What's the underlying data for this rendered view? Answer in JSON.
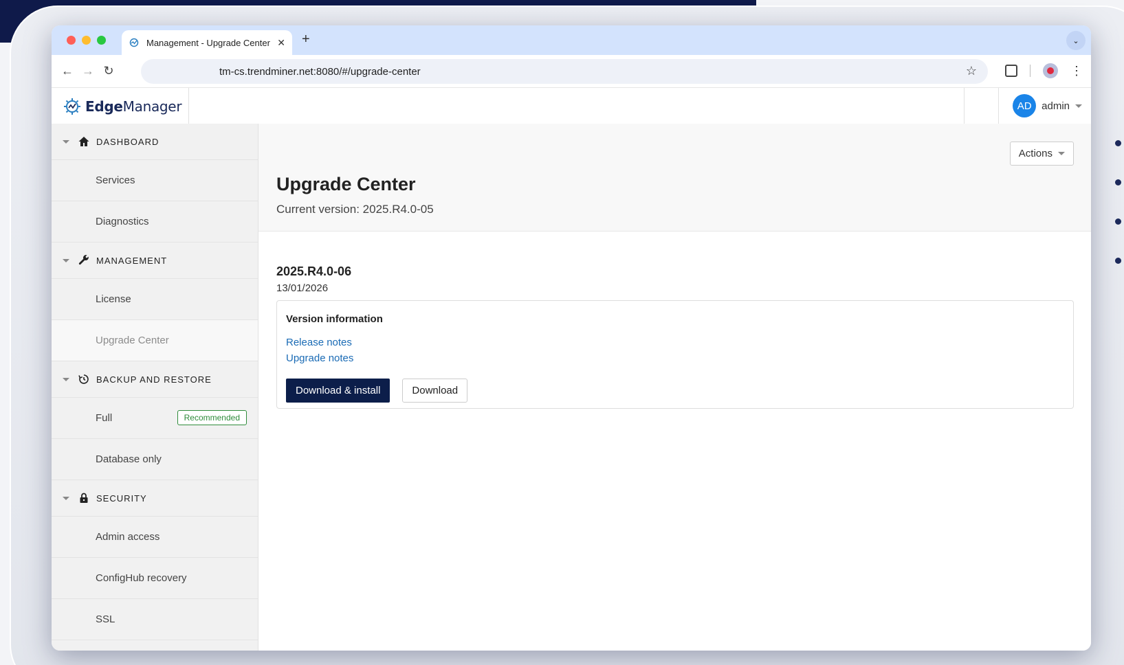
{
  "browser": {
    "tab_title": "Management - Upgrade Center",
    "url": "tm-cs.trendminer.net:8080/#/upgrade-center"
  },
  "app": {
    "brand_bold": "Edge",
    "brand_light": "Manager",
    "user_initials": "AD",
    "user_name": "admin"
  },
  "sidebar": {
    "sections": [
      {
        "label": "DASHBOARD",
        "icon": "home-icon",
        "items": [
          {
            "label": "Services"
          },
          {
            "label": "Diagnostics"
          }
        ]
      },
      {
        "label": "MANAGEMENT",
        "icon": "wrench-icon",
        "items": [
          {
            "label": "License"
          },
          {
            "label": "Upgrade Center",
            "active": true
          }
        ]
      },
      {
        "label": "BACKUP AND RESTORE",
        "icon": "history-icon",
        "items": [
          {
            "label": "Full",
            "badge": "Recommended"
          },
          {
            "label": "Database only"
          }
        ]
      },
      {
        "label": "SECURITY",
        "icon": "lock-icon",
        "items": [
          {
            "label": "Admin access"
          },
          {
            "label": "ConfigHub recovery"
          },
          {
            "label": "SSL"
          }
        ]
      }
    ]
  },
  "main": {
    "actions_label": "Actions",
    "title": "Upgrade Center",
    "current_version": "Current version: 2025.R4.0-05",
    "release": {
      "version": "2025.R4.0-06",
      "date": "13/01/2026",
      "info_title": "Version information",
      "release_notes": "Release notes",
      "upgrade_notes": "Upgrade notes",
      "install_label": "Download & install",
      "download_label": "Download"
    }
  },
  "colors": {
    "primary_button": "#0c1e4a",
    "link": "#1a6bb5",
    "badge": "#2e8b3a",
    "avatar": "#1a84e8"
  }
}
